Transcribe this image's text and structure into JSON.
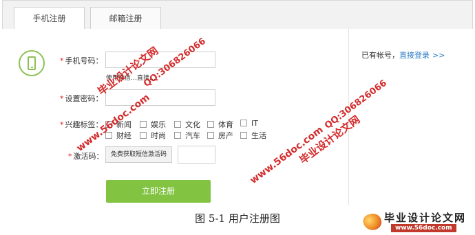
{
  "tabs": [
    {
      "label": "手机注册",
      "active": true
    },
    {
      "label": "邮箱注册",
      "active": false
    }
  ],
  "form": {
    "phone_label": "手机号码：",
    "phone_hint": "使用微信…直接…",
    "password_label": "设置密码：",
    "interests_label": "兴趣标签：",
    "interests": [
      "新闻",
      "娱乐",
      "文化",
      "体育",
      "IT",
      "财经",
      "时尚",
      "汽车",
      "房产",
      "生活"
    ],
    "code_label": "激活码：",
    "get_code_button": "免费获取短信激活码",
    "submit_button": "立即注册",
    "required_mark": "*"
  },
  "side": {
    "have_account": "已有帐号，",
    "login_link": "直接登录",
    "arrow": ">>"
  },
  "caption": "图 5-1  用户注册图",
  "watermarks": {
    "site_name": "毕业设计论文网",
    "qq": "QQ:306826066",
    "url": "www.56doc.com"
  },
  "logo": {
    "title": "毕业设计论文网",
    "url": "www.56doc.com"
  },
  "colors": {
    "accent_green": "#82c341",
    "link_blue": "#2a7ac4",
    "required_red": "#e02020",
    "watermark_red": "#d11a1a"
  }
}
